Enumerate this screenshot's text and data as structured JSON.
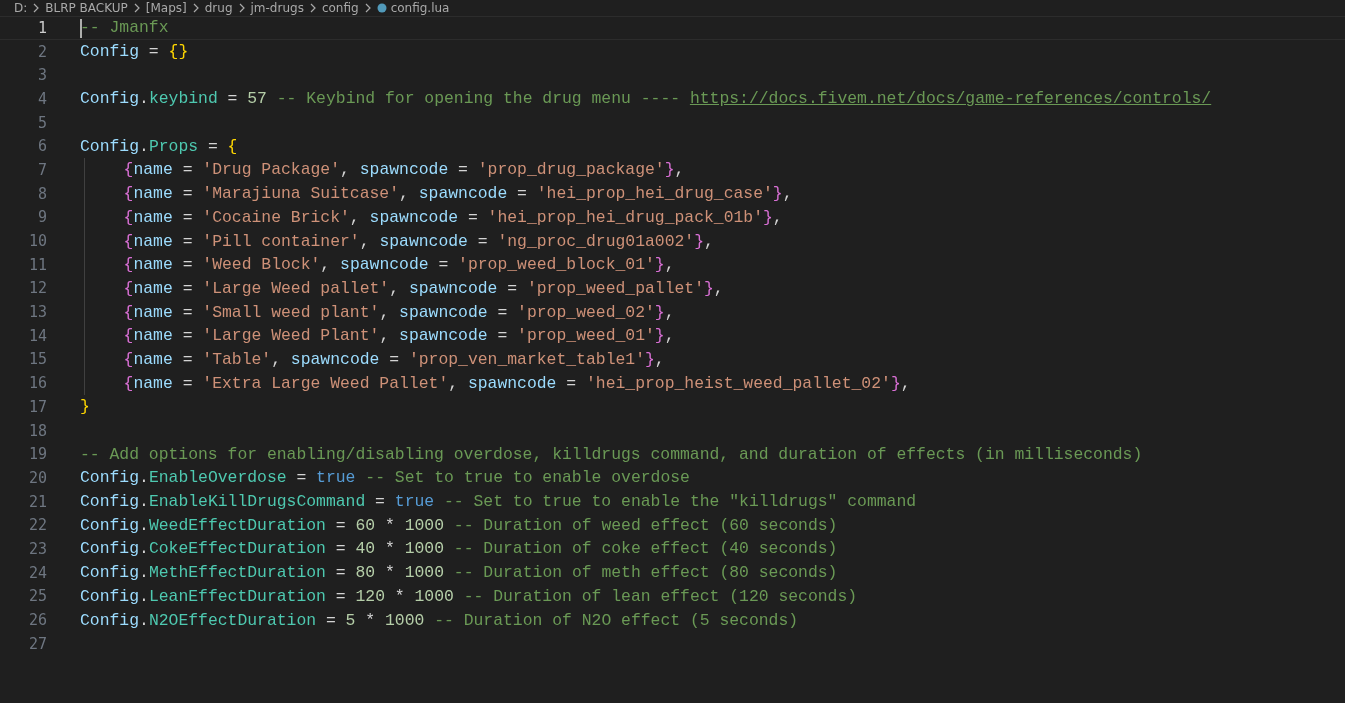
{
  "breadcrumb": [
    {
      "text": "D:"
    },
    {
      "text": "BLRP BACKUP"
    },
    {
      "text": "[Maps]"
    },
    {
      "text": "drug"
    },
    {
      "text": "jm-drugs"
    },
    {
      "text": "config"
    },
    {
      "text": "config.lua",
      "file": true
    }
  ],
  "lines": [
    {
      "number": "1",
      "active": true,
      "cursor": true,
      "tokens": [
        {
          "kind": "comment",
          "text": "-- Jmanfx"
        }
      ]
    },
    {
      "number": "2",
      "active": false,
      "tokens": [
        {
          "kind": "var",
          "text": "Config"
        },
        {
          "kind": "op",
          "text": " = "
        },
        {
          "kind": "brace1",
          "text": "{}"
        }
      ]
    },
    {
      "number": "3",
      "active": false
    },
    {
      "number": "4",
      "active": false,
      "tokens": [
        {
          "kind": "var",
          "text": "Config"
        },
        {
          "kind": "op",
          "text": "."
        },
        {
          "kind": "prop",
          "text": "keybind"
        },
        {
          "kind": "op",
          "text": " = "
        },
        {
          "kind": "num",
          "text": "57"
        },
        {
          "kind": "comment",
          "text": " -- Keybind for opening the drug menu ---- "
        },
        {
          "kind": "link",
          "text": "https://docs.fivem.net/docs/game-references/controls/"
        }
      ]
    },
    {
      "number": "5",
      "active": false
    },
    {
      "number": "6",
      "active": false,
      "tokens": [
        {
          "kind": "var",
          "text": "Config"
        },
        {
          "kind": "op",
          "text": "."
        },
        {
          "kind": "prop",
          "text": "Props"
        },
        {
          "kind": "op",
          "text": " = "
        },
        {
          "kind": "brace1",
          "text": "{"
        }
      ]
    },
    {
      "number": "7",
      "active": false,
      "indent": true,
      "tokens": [
        {
          "kind": "brace2",
          "text": "{"
        },
        {
          "kind": "var",
          "text": "name"
        },
        {
          "kind": "op",
          "text": " = "
        },
        {
          "kind": "str",
          "text": "'Drug Package'"
        },
        {
          "kind": "op",
          "text": ", "
        },
        {
          "kind": "var",
          "text": "spawncode"
        },
        {
          "kind": "op",
          "text": " = "
        },
        {
          "kind": "str",
          "text": "'prop_drug_package'"
        },
        {
          "kind": "brace2",
          "text": "}"
        },
        {
          "kind": "op",
          "text": ","
        }
      ]
    },
    {
      "number": "8",
      "active": false,
      "indent": true,
      "tokens": [
        {
          "kind": "brace2",
          "text": "{"
        },
        {
          "kind": "var",
          "text": "name"
        },
        {
          "kind": "op",
          "text": " = "
        },
        {
          "kind": "str",
          "text": "'Marajiuna Suitcase'"
        },
        {
          "kind": "op",
          "text": ", "
        },
        {
          "kind": "var",
          "text": "spawncode"
        },
        {
          "kind": "op",
          "text": " = "
        },
        {
          "kind": "str",
          "text": "'hei_prop_hei_drug_case'"
        },
        {
          "kind": "brace2",
          "text": "}"
        },
        {
          "kind": "op",
          "text": ","
        }
      ]
    },
    {
      "number": "9",
      "active": false,
      "indent": true,
      "tokens": [
        {
          "kind": "brace2",
          "text": "{"
        },
        {
          "kind": "var",
          "text": "name"
        },
        {
          "kind": "op",
          "text": " = "
        },
        {
          "kind": "str",
          "text": "'Cocaine Brick'"
        },
        {
          "kind": "op",
          "text": ", "
        },
        {
          "kind": "var",
          "text": "spawncode"
        },
        {
          "kind": "op",
          "text": " = "
        },
        {
          "kind": "str",
          "text": "'hei_prop_hei_drug_pack_01b'"
        },
        {
          "kind": "brace2",
          "text": "}"
        },
        {
          "kind": "op",
          "text": ","
        }
      ]
    },
    {
      "number": "10",
      "active": false,
      "indent": true,
      "tokens": [
        {
          "kind": "brace2",
          "text": "{"
        },
        {
          "kind": "var",
          "text": "name"
        },
        {
          "kind": "op",
          "text": " = "
        },
        {
          "kind": "str",
          "text": "'Pill container'"
        },
        {
          "kind": "op",
          "text": ", "
        },
        {
          "kind": "var",
          "text": "spawncode"
        },
        {
          "kind": "op",
          "text": " = "
        },
        {
          "kind": "str",
          "text": "'ng_proc_drug01a002'"
        },
        {
          "kind": "brace2",
          "text": "}"
        },
        {
          "kind": "op",
          "text": ","
        }
      ]
    },
    {
      "number": "11",
      "active": false,
      "indent": true,
      "tokens": [
        {
          "kind": "brace2",
          "text": "{"
        },
        {
          "kind": "var",
          "text": "name"
        },
        {
          "kind": "op",
          "text": " = "
        },
        {
          "kind": "str",
          "text": "'Weed Block'"
        },
        {
          "kind": "op",
          "text": ", "
        },
        {
          "kind": "var",
          "text": "spawncode"
        },
        {
          "kind": "op",
          "text": " = "
        },
        {
          "kind": "str",
          "text": "'prop_weed_block_01'"
        },
        {
          "kind": "brace2",
          "text": "}"
        },
        {
          "kind": "op",
          "text": ","
        }
      ]
    },
    {
      "number": "12",
      "active": false,
      "indent": true,
      "tokens": [
        {
          "kind": "brace2",
          "text": "{"
        },
        {
          "kind": "var",
          "text": "name"
        },
        {
          "kind": "op",
          "text": " = "
        },
        {
          "kind": "str",
          "text": "'Large Weed pallet'"
        },
        {
          "kind": "op",
          "text": ", "
        },
        {
          "kind": "var",
          "text": "spawncode"
        },
        {
          "kind": "op",
          "text": " = "
        },
        {
          "kind": "str",
          "text": "'prop_weed_pallet'"
        },
        {
          "kind": "brace2",
          "text": "}"
        },
        {
          "kind": "op",
          "text": ","
        }
      ]
    },
    {
      "number": "13",
      "active": false,
      "indent": true,
      "tokens": [
        {
          "kind": "brace2",
          "text": "{"
        },
        {
          "kind": "var",
          "text": "name"
        },
        {
          "kind": "op",
          "text": " = "
        },
        {
          "kind": "str",
          "text": "'Small weed plant'"
        },
        {
          "kind": "op",
          "text": ", "
        },
        {
          "kind": "var",
          "text": "spawncode"
        },
        {
          "kind": "op",
          "text": " = "
        },
        {
          "kind": "str",
          "text": "'prop_weed_02'"
        },
        {
          "kind": "brace2",
          "text": "}"
        },
        {
          "kind": "op",
          "text": ","
        }
      ]
    },
    {
      "number": "14",
      "active": false,
      "indent": true,
      "tokens": [
        {
          "kind": "brace2",
          "text": "{"
        },
        {
          "kind": "var",
          "text": "name"
        },
        {
          "kind": "op",
          "text": " = "
        },
        {
          "kind": "str",
          "text": "'Large Weed Plant'"
        },
        {
          "kind": "op",
          "text": ", "
        },
        {
          "kind": "var",
          "text": "spawncode"
        },
        {
          "kind": "op",
          "text": " = "
        },
        {
          "kind": "str",
          "text": "'prop_weed_01'"
        },
        {
          "kind": "brace2",
          "text": "}"
        },
        {
          "kind": "op",
          "text": ","
        }
      ]
    },
    {
      "number": "15",
      "active": false,
      "indent": true,
      "tokens": [
        {
          "kind": "brace2",
          "text": "{"
        },
        {
          "kind": "var",
          "text": "name"
        },
        {
          "kind": "op",
          "text": " = "
        },
        {
          "kind": "str",
          "text": "'Table'"
        },
        {
          "kind": "op",
          "text": ", "
        },
        {
          "kind": "var",
          "text": "spawncode"
        },
        {
          "kind": "op",
          "text": " = "
        },
        {
          "kind": "str",
          "text": "'prop_ven_market_table1'"
        },
        {
          "kind": "brace2",
          "text": "}"
        },
        {
          "kind": "op",
          "text": ","
        }
      ]
    },
    {
      "number": "16",
      "active": false,
      "indent": true,
      "tokens": [
        {
          "kind": "brace2",
          "text": "{"
        },
        {
          "kind": "var",
          "text": "name"
        },
        {
          "kind": "op",
          "text": " = "
        },
        {
          "kind": "str",
          "text": "'Extra Large Weed Pallet'"
        },
        {
          "kind": "op",
          "text": ", "
        },
        {
          "kind": "var",
          "text": "spawncode"
        },
        {
          "kind": "op",
          "text": " = "
        },
        {
          "kind": "str",
          "text": "'hei_prop_heist_weed_pallet_02'"
        },
        {
          "kind": "brace2",
          "text": "}"
        },
        {
          "kind": "op",
          "text": ","
        }
      ]
    },
    {
      "number": "17",
      "active": false,
      "tokens": [
        {
          "kind": "brace1",
          "text": "}"
        }
      ]
    },
    {
      "number": "18",
      "active": false
    },
    {
      "number": "19",
      "active": false,
      "tokens": [
        {
          "kind": "comment",
          "text": "-- Add options for enabling/disabling overdose, killdrugs command, and duration of effects (in milliseconds)"
        }
      ]
    },
    {
      "number": "20",
      "active": false,
      "tokens": [
        {
          "kind": "var",
          "text": "Config"
        },
        {
          "kind": "op",
          "text": "."
        },
        {
          "kind": "prop",
          "text": "EnableOverdose"
        },
        {
          "kind": "op",
          "text": " = "
        },
        {
          "kind": "keyword",
          "text": "true"
        },
        {
          "kind": "comment",
          "text": " -- Set to true to enable overdose"
        }
      ]
    },
    {
      "number": "21",
      "active": false,
      "tokens": [
        {
          "kind": "var",
          "text": "Config"
        },
        {
          "kind": "op",
          "text": "."
        },
        {
          "kind": "prop",
          "text": "EnableKillDrugsCommand"
        },
        {
          "kind": "op",
          "text": " = "
        },
        {
          "kind": "keyword",
          "text": "true"
        },
        {
          "kind": "comment",
          "text": " -- Set to true to enable the \"killdrugs\" command"
        }
      ]
    },
    {
      "number": "22",
      "active": false,
      "tokens": [
        {
          "kind": "var",
          "text": "Config"
        },
        {
          "kind": "op",
          "text": "."
        },
        {
          "kind": "prop",
          "text": "WeedEffectDuration"
        },
        {
          "kind": "op",
          "text": " = "
        },
        {
          "kind": "num",
          "text": "60"
        },
        {
          "kind": "op",
          "text": " * "
        },
        {
          "kind": "num",
          "text": "1000"
        },
        {
          "kind": "comment",
          "text": " -- Duration of weed effect (60 seconds)"
        }
      ]
    },
    {
      "number": "23",
      "active": false,
      "tokens": [
        {
          "kind": "var",
          "text": "Config"
        },
        {
          "kind": "op",
          "text": "."
        },
        {
          "kind": "prop",
          "text": "CokeEffectDuration"
        },
        {
          "kind": "op",
          "text": " = "
        },
        {
          "kind": "num",
          "text": "40"
        },
        {
          "kind": "op",
          "text": " * "
        },
        {
          "kind": "num",
          "text": "1000"
        },
        {
          "kind": "comment",
          "text": " -- Duration of coke effect (40 seconds)"
        }
      ]
    },
    {
      "number": "24",
      "active": false,
      "tokens": [
        {
          "kind": "var",
          "text": "Config"
        },
        {
          "kind": "op",
          "text": "."
        },
        {
          "kind": "prop",
          "text": "MethEffectDuration"
        },
        {
          "kind": "op",
          "text": " = "
        },
        {
          "kind": "num",
          "text": "80"
        },
        {
          "kind": "op",
          "text": " * "
        },
        {
          "kind": "num",
          "text": "1000"
        },
        {
          "kind": "comment",
          "text": " -- Duration of meth effect (80 seconds)"
        }
      ]
    },
    {
      "number": "25",
      "active": false,
      "tokens": [
        {
          "kind": "var",
          "text": "Config"
        },
        {
          "kind": "op",
          "text": "."
        },
        {
          "kind": "prop",
          "text": "LeanEffectDuration"
        },
        {
          "kind": "op",
          "text": " = "
        },
        {
          "kind": "num",
          "text": "120"
        },
        {
          "kind": "op",
          "text": " * "
        },
        {
          "kind": "num",
          "text": "1000"
        },
        {
          "kind": "comment",
          "text": " -- Duration of lean effect (120 seconds)"
        }
      ]
    },
    {
      "number": "26",
      "active": false,
      "tokens": [
        {
          "kind": "var",
          "text": "Config"
        },
        {
          "kind": "op",
          "text": "."
        },
        {
          "kind": "prop",
          "text": "N2OEffectDuration"
        },
        {
          "kind": "op",
          "text": " = "
        },
        {
          "kind": "num",
          "text": "5"
        },
        {
          "kind": "op",
          "text": " * "
        },
        {
          "kind": "num",
          "text": "1000"
        },
        {
          "kind": "comment",
          "text": " -- Duration of N2O effect (5 seconds)"
        }
      ]
    },
    {
      "number": "27",
      "active": false
    }
  ]
}
